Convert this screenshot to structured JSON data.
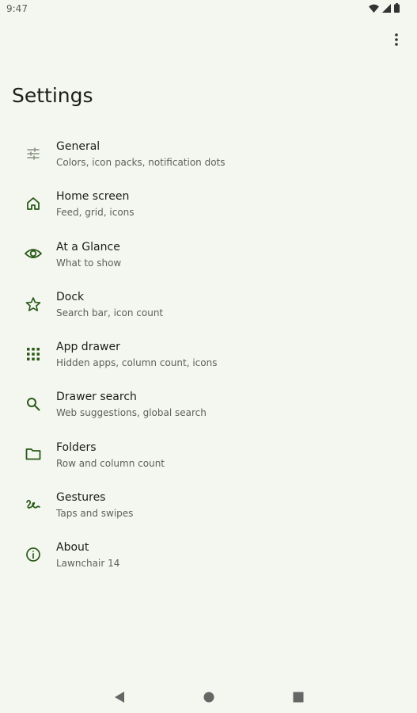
{
  "status_bar": {
    "time": "9:47"
  },
  "header": {
    "title": "Settings"
  },
  "theme": {
    "icon_color": "#2c5a1a",
    "background": "#f3f7ef"
  },
  "settings": [
    {
      "icon": "tune-icon",
      "label": "General",
      "summary": "Colors, icon packs, notification dots"
    },
    {
      "icon": "home-icon",
      "label": "Home screen",
      "summary": "Feed, grid, icons"
    },
    {
      "icon": "eye-icon",
      "label": "At a Glance",
      "summary": "What to show"
    },
    {
      "icon": "star-icon",
      "label": "Dock",
      "summary": "Search bar, icon count"
    },
    {
      "icon": "grid-icon",
      "label": "App drawer",
      "summary": "Hidden apps, column count, icons"
    },
    {
      "icon": "search-icon",
      "label": "Drawer search",
      "summary": "Web suggestions, global search"
    },
    {
      "icon": "folder-icon",
      "label": "Folders",
      "summary": "Row and column count"
    },
    {
      "icon": "gesture-icon",
      "label": "Gestures",
      "summary": "Taps and swipes"
    },
    {
      "icon": "info-icon",
      "label": "About",
      "summary": "Lawnchair 14"
    }
  ]
}
